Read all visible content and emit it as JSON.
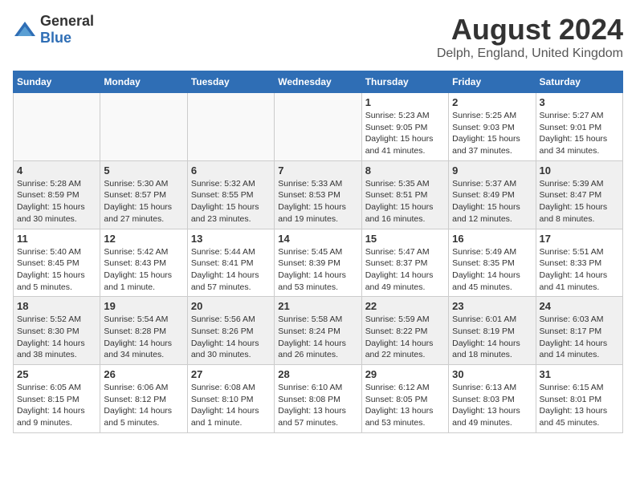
{
  "header": {
    "logo": {
      "general": "General",
      "blue": "Blue"
    },
    "title": "August 2024",
    "subtitle": "Delph, England, United Kingdom"
  },
  "calendar": {
    "headers": [
      "Sunday",
      "Monday",
      "Tuesday",
      "Wednesday",
      "Thursday",
      "Friday",
      "Saturday"
    ],
    "weeks": [
      [
        {
          "day": "",
          "detail": ""
        },
        {
          "day": "",
          "detail": ""
        },
        {
          "day": "",
          "detail": ""
        },
        {
          "day": "",
          "detail": ""
        },
        {
          "day": "1",
          "detail": "Sunrise: 5:23 AM\nSunset: 9:05 PM\nDaylight: 15 hours\nand 41 minutes."
        },
        {
          "day": "2",
          "detail": "Sunrise: 5:25 AM\nSunset: 9:03 PM\nDaylight: 15 hours\nand 37 minutes."
        },
        {
          "day": "3",
          "detail": "Sunrise: 5:27 AM\nSunset: 9:01 PM\nDaylight: 15 hours\nand 34 minutes."
        }
      ],
      [
        {
          "day": "4",
          "detail": "Sunrise: 5:28 AM\nSunset: 8:59 PM\nDaylight: 15 hours\nand 30 minutes."
        },
        {
          "day": "5",
          "detail": "Sunrise: 5:30 AM\nSunset: 8:57 PM\nDaylight: 15 hours\nand 27 minutes."
        },
        {
          "day": "6",
          "detail": "Sunrise: 5:32 AM\nSunset: 8:55 PM\nDaylight: 15 hours\nand 23 minutes."
        },
        {
          "day": "7",
          "detail": "Sunrise: 5:33 AM\nSunset: 8:53 PM\nDaylight: 15 hours\nand 19 minutes."
        },
        {
          "day": "8",
          "detail": "Sunrise: 5:35 AM\nSunset: 8:51 PM\nDaylight: 15 hours\nand 16 minutes."
        },
        {
          "day": "9",
          "detail": "Sunrise: 5:37 AM\nSunset: 8:49 PM\nDaylight: 15 hours\nand 12 minutes."
        },
        {
          "day": "10",
          "detail": "Sunrise: 5:39 AM\nSunset: 8:47 PM\nDaylight: 15 hours\nand 8 minutes."
        }
      ],
      [
        {
          "day": "11",
          "detail": "Sunrise: 5:40 AM\nSunset: 8:45 PM\nDaylight: 15 hours\nand 5 minutes."
        },
        {
          "day": "12",
          "detail": "Sunrise: 5:42 AM\nSunset: 8:43 PM\nDaylight: 15 hours\nand 1 minute."
        },
        {
          "day": "13",
          "detail": "Sunrise: 5:44 AM\nSunset: 8:41 PM\nDaylight: 14 hours\nand 57 minutes."
        },
        {
          "day": "14",
          "detail": "Sunrise: 5:45 AM\nSunset: 8:39 PM\nDaylight: 14 hours\nand 53 minutes."
        },
        {
          "day": "15",
          "detail": "Sunrise: 5:47 AM\nSunset: 8:37 PM\nDaylight: 14 hours\nand 49 minutes."
        },
        {
          "day": "16",
          "detail": "Sunrise: 5:49 AM\nSunset: 8:35 PM\nDaylight: 14 hours\nand 45 minutes."
        },
        {
          "day": "17",
          "detail": "Sunrise: 5:51 AM\nSunset: 8:33 PM\nDaylight: 14 hours\nand 41 minutes."
        }
      ],
      [
        {
          "day": "18",
          "detail": "Sunrise: 5:52 AM\nSunset: 8:30 PM\nDaylight: 14 hours\nand 38 minutes."
        },
        {
          "day": "19",
          "detail": "Sunrise: 5:54 AM\nSunset: 8:28 PM\nDaylight: 14 hours\nand 34 minutes."
        },
        {
          "day": "20",
          "detail": "Sunrise: 5:56 AM\nSunset: 8:26 PM\nDaylight: 14 hours\nand 30 minutes."
        },
        {
          "day": "21",
          "detail": "Sunrise: 5:58 AM\nSunset: 8:24 PM\nDaylight: 14 hours\nand 26 minutes."
        },
        {
          "day": "22",
          "detail": "Sunrise: 5:59 AM\nSunset: 8:22 PM\nDaylight: 14 hours\nand 22 minutes."
        },
        {
          "day": "23",
          "detail": "Sunrise: 6:01 AM\nSunset: 8:19 PM\nDaylight: 14 hours\nand 18 minutes."
        },
        {
          "day": "24",
          "detail": "Sunrise: 6:03 AM\nSunset: 8:17 PM\nDaylight: 14 hours\nand 14 minutes."
        }
      ],
      [
        {
          "day": "25",
          "detail": "Sunrise: 6:05 AM\nSunset: 8:15 PM\nDaylight: 14 hours\nand 9 minutes."
        },
        {
          "day": "26",
          "detail": "Sunrise: 6:06 AM\nSunset: 8:12 PM\nDaylight: 14 hours\nand 5 minutes."
        },
        {
          "day": "27",
          "detail": "Sunrise: 6:08 AM\nSunset: 8:10 PM\nDaylight: 14 hours\nand 1 minute."
        },
        {
          "day": "28",
          "detail": "Sunrise: 6:10 AM\nSunset: 8:08 PM\nDaylight: 13 hours\nand 57 minutes."
        },
        {
          "day": "29",
          "detail": "Sunrise: 6:12 AM\nSunset: 8:05 PM\nDaylight: 13 hours\nand 53 minutes."
        },
        {
          "day": "30",
          "detail": "Sunrise: 6:13 AM\nSunset: 8:03 PM\nDaylight: 13 hours\nand 49 minutes."
        },
        {
          "day": "31",
          "detail": "Sunrise: 6:15 AM\nSunset: 8:01 PM\nDaylight: 13 hours\nand 45 minutes."
        }
      ]
    ]
  }
}
